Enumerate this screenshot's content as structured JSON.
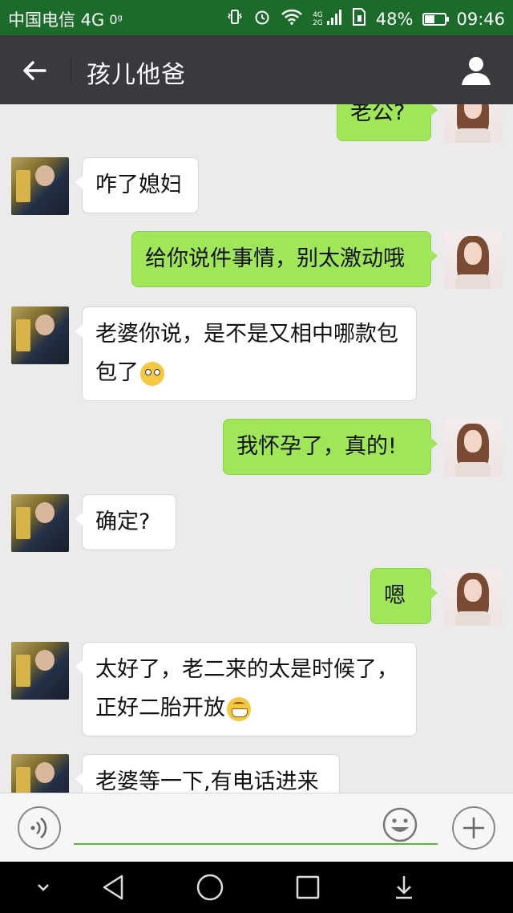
{
  "status_bar": {
    "carrier": "中国电信 4G",
    "hd_tag": "0ᵍ",
    "net_top": "4G",
    "net_bottom": "2G",
    "battery_percent_label": "48%",
    "battery_level": 0.48,
    "time": "09:46",
    "icons": [
      "vibrate-icon",
      "alarm-icon",
      "wifi-icon",
      "signal-icon",
      "sim-icon",
      "battery-icon"
    ]
  },
  "header": {
    "title": "孩儿他爸",
    "back_icon": "back-arrow-icon",
    "contact_icon": "contact-person-icon"
  },
  "messages": [
    {
      "side": "out",
      "sender": "wife",
      "text": "老公?",
      "emoji": null
    },
    {
      "side": "in",
      "sender": "husband",
      "text": "咋了媳妇",
      "emoji": null
    },
    {
      "side": "out",
      "sender": "wife",
      "text": "给你说件事情，别太激动哦",
      "emoji": null
    },
    {
      "side": "in",
      "sender": "husband",
      "text": "老婆你说，是不是又相中哪款包包了",
      "emoji": "shocked-emoji"
    },
    {
      "side": "out",
      "sender": "wife",
      "text": "我怀孕了，真的!",
      "emoji": null
    },
    {
      "side": "in",
      "sender": "husband",
      "text": "确定?",
      "emoji": null
    },
    {
      "side": "out",
      "sender": "wife",
      "text": "嗯",
      "emoji": null
    },
    {
      "side": "in",
      "sender": "husband",
      "text": "太好了，老二来的太是时候了，正好二胎开放",
      "emoji": "grinning-emoji"
    },
    {
      "side": "in",
      "sender": "husband",
      "text": "老婆等一下,有电话进来",
      "emoji": null
    }
  ],
  "input_bar": {
    "voice_icon": "voice-icon",
    "emoji_icon": "emoji-icon",
    "plus_icon": "plus-icon",
    "value": ""
  },
  "nav_bar": {
    "icons": [
      "collapse-icon",
      "back-triangle-icon",
      "home-circle-icon",
      "recents-square-icon",
      "notification-pull-icon"
    ]
  },
  "colors": {
    "status_bar": "#1b6b2a",
    "title_bar": "#393a3f",
    "chat_bg": "#ebebeb",
    "bubble_out": "#9fe658",
    "bubble_in": "#ffffff",
    "input_underline": "#5fb336"
  }
}
